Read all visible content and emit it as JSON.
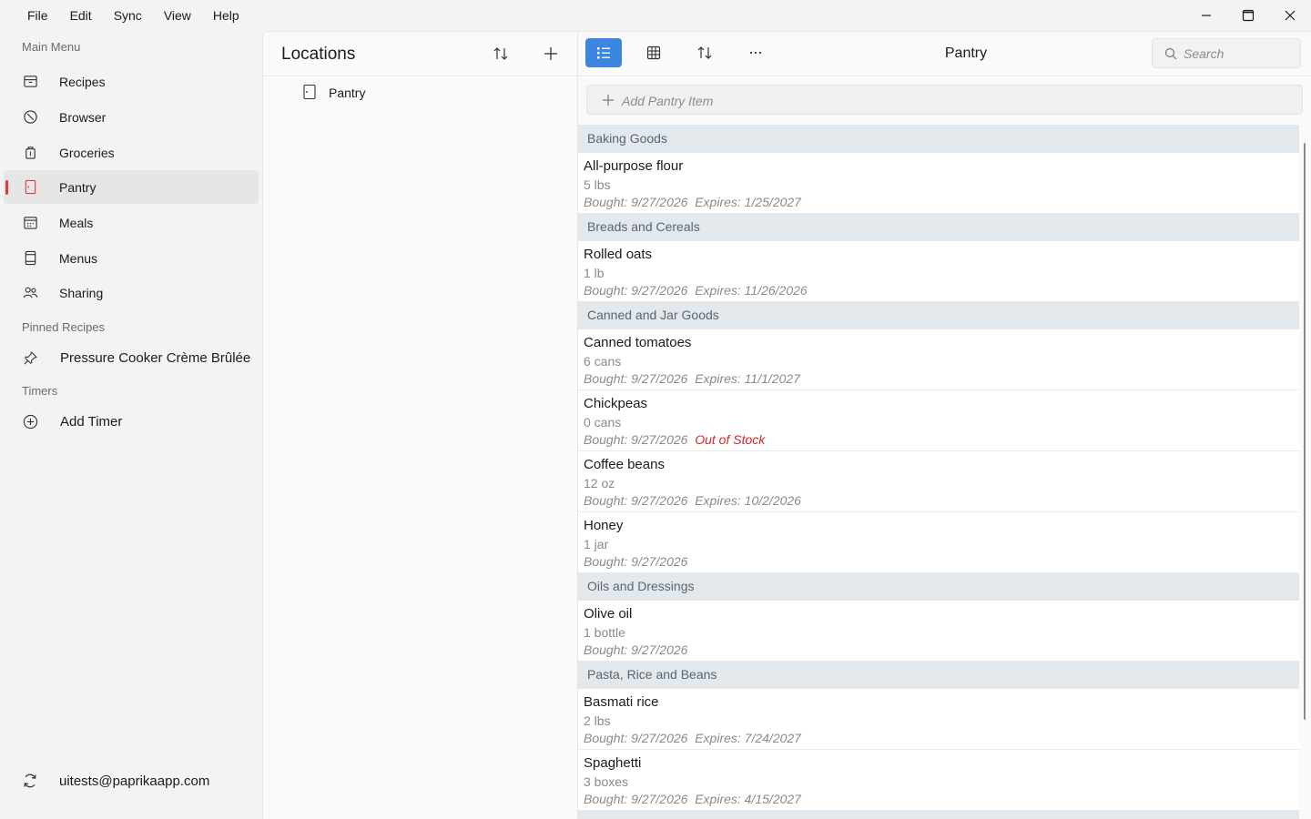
{
  "menubar": {
    "items": [
      "File",
      "Edit",
      "Sync",
      "View",
      "Help"
    ]
  },
  "sidebar": {
    "main_menu_label": "Main Menu",
    "items": [
      {
        "label": "Recipes",
        "icon": "recipes-box-icon"
      },
      {
        "label": "Browser",
        "icon": "compass-icon"
      },
      {
        "label": "Groceries",
        "icon": "grocery-bag-icon"
      },
      {
        "label": "Pantry",
        "icon": "pantry-cabinet-icon",
        "active": true
      },
      {
        "label": "Meals",
        "icon": "calendar-icon"
      },
      {
        "label": "Menus",
        "icon": "menu-book-icon"
      },
      {
        "label": "Sharing",
        "icon": "people-icon"
      }
    ],
    "pinned_label": "Pinned Recipes",
    "pinned_items": [
      {
        "label": "Pressure Cooker Crème Brûlée",
        "icon": "pin-icon"
      }
    ],
    "timers_label": "Timers",
    "add_timer_label": "Add Timer",
    "account": "uitests@paprikaapp.com",
    "accent_color": "#e03a3a"
  },
  "locations": {
    "title": "Locations",
    "items": [
      {
        "label": "Pantry",
        "icon": "pantry-cabinet-icon"
      }
    ]
  },
  "main": {
    "title": "Pantry",
    "search_placeholder": "Search",
    "add_label": "Add Pantry Item",
    "active_view_color": "#3d86e0",
    "categories": [
      {
        "name": "Baking Goods",
        "items": [
          {
            "name": "All-purpose flour",
            "qty": "5 lbs",
            "bought": "Bought: 9/27/2026",
            "expires": "Expires: 1/25/2027"
          }
        ]
      },
      {
        "name": "Breads and Cereals",
        "items": [
          {
            "name": "Rolled oats",
            "qty": "1 lb",
            "bought": "Bought: 9/27/2026",
            "expires": "Expires: 11/26/2026"
          }
        ]
      },
      {
        "name": "Canned and Jar Goods",
        "items": [
          {
            "name": "Canned tomatoes",
            "qty": "6 cans",
            "bought": "Bought: 9/27/2026",
            "expires": "Expires: 11/1/2027"
          },
          {
            "name": "Chickpeas",
            "qty": "0 cans",
            "bought": "Bought: 9/27/2026",
            "out_of_stock": "Out of Stock"
          },
          {
            "name": "Coffee beans",
            "qty": "12 oz",
            "bought": "Bought: 9/27/2026",
            "expires": "Expires: 10/2/2026"
          },
          {
            "name": "Honey",
            "qty": "1 jar",
            "bought": "Bought: 9/27/2026"
          }
        ]
      },
      {
        "name": "Oils and Dressings",
        "items": [
          {
            "name": "Olive oil",
            "qty": "1 bottle",
            "bought": "Bought: 9/27/2026"
          }
        ]
      },
      {
        "name": "Pasta, Rice and Beans",
        "items": [
          {
            "name": "Basmati rice",
            "qty": "2 lbs",
            "bought": "Bought: 9/27/2026",
            "expires": "Expires: 7/24/2027"
          },
          {
            "name": "Spaghetti",
            "qty": "3 boxes",
            "bought": "Bought: 9/27/2026",
            "expires": "Expires: 4/15/2027"
          }
        ]
      },
      {
        "name": "",
        "items": []
      }
    ]
  }
}
